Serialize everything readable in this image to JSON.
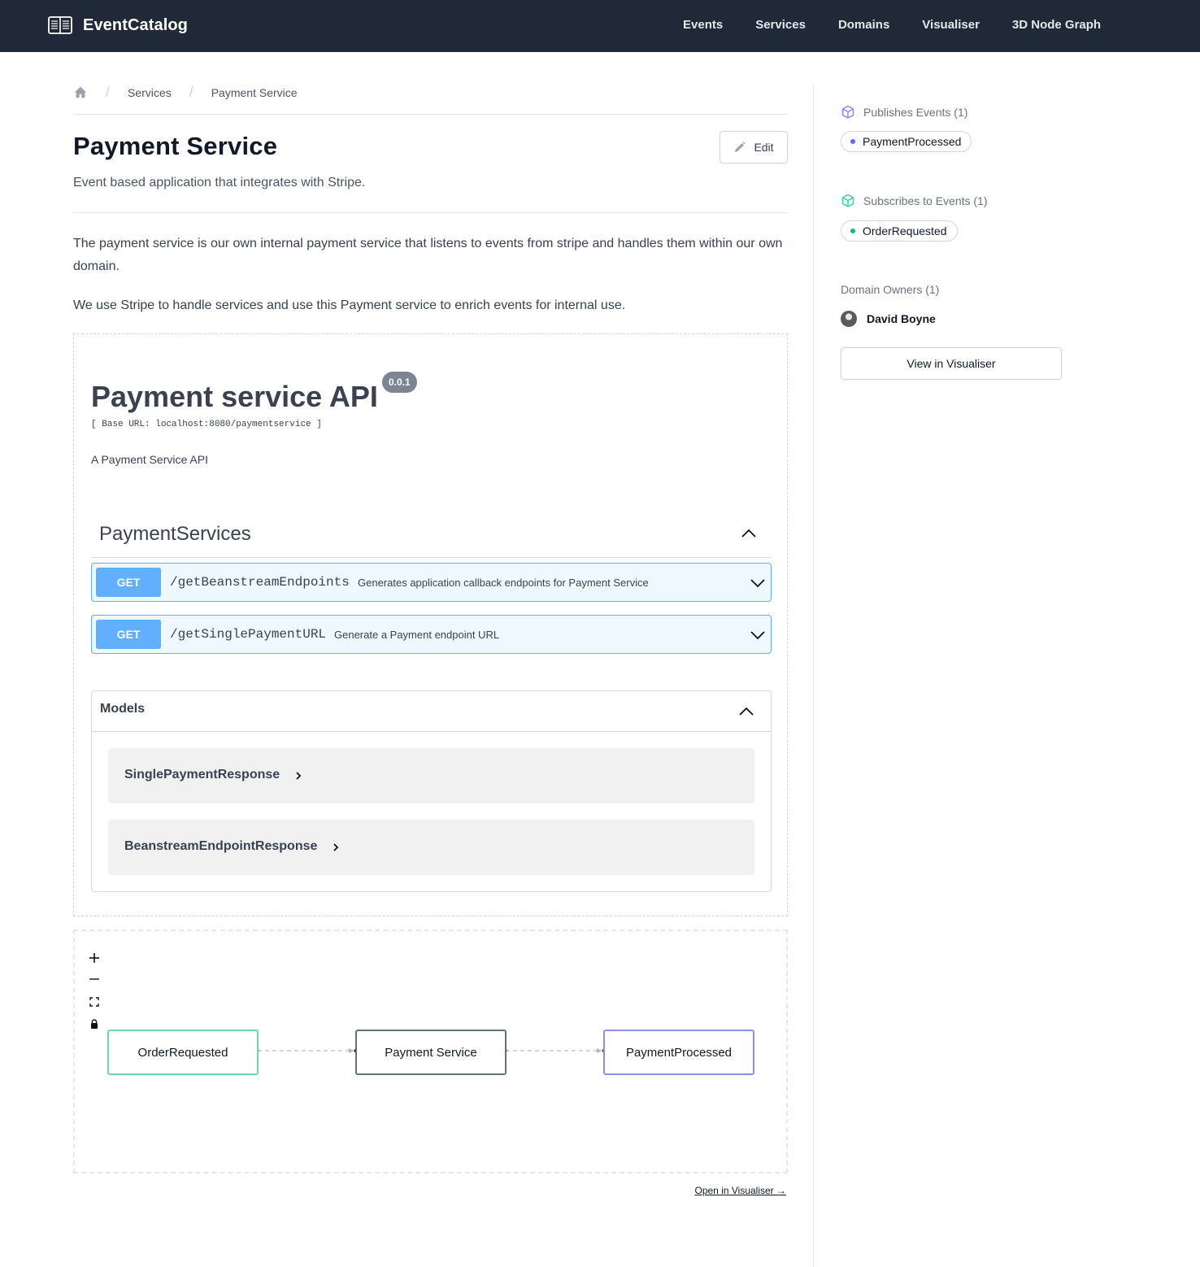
{
  "navbar": {
    "brand": "EventCatalog",
    "links": [
      "Events",
      "Services",
      "Domains",
      "Visualiser",
      "3D Node Graph"
    ]
  },
  "breadcrumb": {
    "home_icon": "home-icon",
    "items": [
      "Services",
      "Payment Service"
    ],
    "separator": "/"
  },
  "page": {
    "title": "Payment Service",
    "edit_label": "Edit",
    "summary": "Event based application that integrates with Stripe.",
    "paragraphs": [
      "The payment service is our own internal payment service that listens to events from stripe and handles them within our own domain.",
      "We use Stripe to handle services and use this Payment service to enrich events for internal use."
    ]
  },
  "api": {
    "title": "Payment service API",
    "version": "0.0.1",
    "base_url": "[ Base URL: localhost:8080/paymentservice ]",
    "description": "A Payment Service API",
    "tag": "PaymentServices",
    "operations": [
      {
        "method": "GET",
        "path": "/getBeanstreamEndpoints",
        "summary": "Generates application callback endpoints for Payment Service"
      },
      {
        "method": "GET",
        "path": "/getSinglePaymentURL",
        "summary": "Generate a Payment endpoint URL"
      }
    ],
    "models_title": "Models",
    "models": [
      "SinglePaymentResponse",
      "BeanstreamEndpointResponse"
    ],
    "method_color": "#61affe"
  },
  "flow": {
    "controls": [
      "zoom-in-icon",
      "zoom-out-icon",
      "fit-view-icon",
      "lock-icon"
    ],
    "nodes": [
      "OrderRequested",
      "Payment Service",
      "PaymentProcessed"
    ],
    "open_link": "Open in Visualiser →"
  },
  "sidebar": {
    "publishes_title": "Publishes Events (1)",
    "publishes": [
      "PaymentProcessed"
    ],
    "subscribes_title": "Subscribes to Events (1)",
    "subscribes": [
      "OrderRequested"
    ],
    "owners_title": "Domain Owners (1)",
    "owners": [
      "David Boyne"
    ],
    "visualiser_button": "View in Visualiser",
    "publish_color": "#6366f1",
    "subscribe_color": "#10b981"
  }
}
